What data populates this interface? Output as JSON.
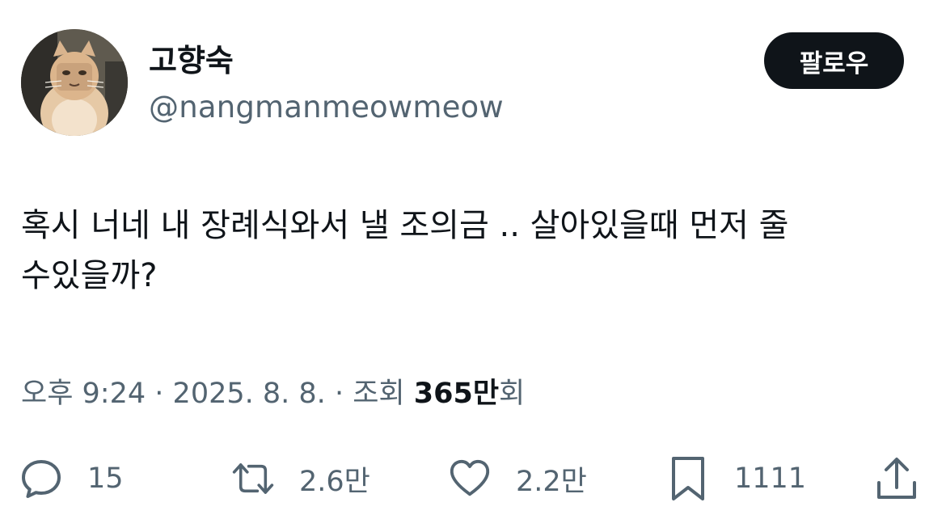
{
  "author": {
    "display_name": "고향숙",
    "handle": "@nangmanmeowmeow"
  },
  "follow_button": {
    "label": "팔로우"
  },
  "tweet": {
    "text": "혹시 너네 내 장례식와서 낼 조의금 .. 살아있을때 먼저 줄\n수있을까?"
  },
  "meta": {
    "time": "오후 9:24",
    "separator": "·",
    "date": "2025. 8. 8.",
    "views_prefix": "조회",
    "views_count": "365만",
    "views_suffix": "회"
  },
  "actions": {
    "reply": {
      "icon": "reply-icon",
      "count": "15"
    },
    "retweet": {
      "icon": "retweet-icon",
      "count": "2.6만"
    },
    "like": {
      "icon": "heart-icon",
      "count": "2.2만"
    },
    "bookmark": {
      "icon": "bookmark-icon",
      "count": "1111"
    },
    "share": {
      "icon": "share-icon"
    }
  },
  "colors": {
    "text_primary": "#0f1419",
    "text_secondary": "#536471",
    "follow_button_bg": "#0f1419",
    "follow_button_text": "#ffffff",
    "background": "#ffffff"
  }
}
